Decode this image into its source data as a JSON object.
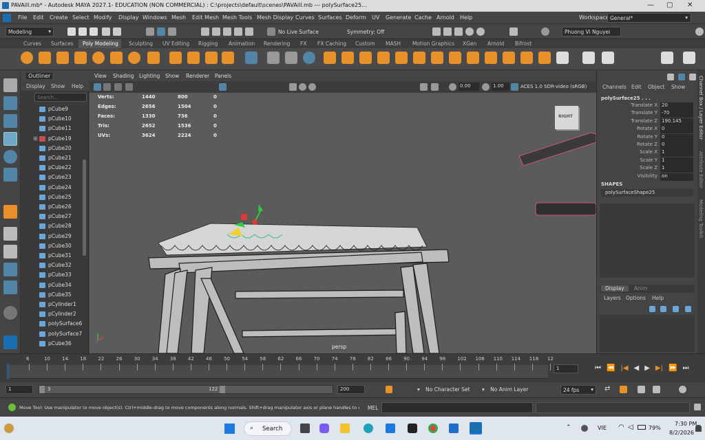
{
  "window": {
    "title": "PAVAill.mb* - Autodesk MAYA 2027.1- EDUCATION (NON COMMERCIAL) : C:\\projects\\default\\scenes\\PAVAill.mb  ---  polySurface25...",
    "minimize": "—",
    "maximize": "▢",
    "close": "✕"
  },
  "menubar": [
    "File",
    "Edit",
    "Create",
    "Select",
    "Modify",
    "Display",
    "Windows",
    "Mesh",
    "Edit Mesh",
    "Mesh Tools",
    "Mesh Display",
    "Curves",
    "Surfaces",
    "Deform",
    "UV",
    "Generate",
    "Cache",
    "Arnold",
    "Help"
  ],
  "workspace": {
    "label": "Workspace:",
    "value": "General*"
  },
  "statusline": {
    "mode": "Modeling",
    "live_surface": "No Live Surface",
    "symmetry": "Symmetry: Off",
    "user": "Phuong Vi Nguyei"
  },
  "shelf_tabs": [
    "Curves",
    "Surfaces",
    "Poly Modeling",
    "Sculpting",
    "UV Editing",
    "Rigging",
    "Animation",
    "Rendering",
    "FX",
    "FX Caching",
    "Custom",
    "MASH",
    "Motion Graphics",
    "XGen",
    "Arnold",
    "Bifrost"
  ],
  "shelf_active": "Poly Modeling",
  "outliner": {
    "title": "Outliner",
    "menu": [
      "Display",
      "Show",
      "Help"
    ],
    "search_placeholder": "Search...",
    "items": [
      "pCube9",
      "pCube10",
      "pCube11",
      "pCube19",
      "pCube20",
      "pCube21",
      "pCube22",
      "pCube23",
      "pCube24",
      "pCube25",
      "pCube26",
      "pCube27",
      "pCube28",
      "pCube29",
      "pCube30",
      "pCube31",
      "pCube32",
      "pCube33",
      "pCube34",
      "pCube35",
      "pCylinder1",
      "pCylinder2",
      "polySurface6",
      "polySurface7",
      "pCube36"
    ]
  },
  "viewport": {
    "menu": [
      "View",
      "Shading",
      "Lighting",
      "Show",
      "Renderer",
      "Panels"
    ],
    "exposure": "0.00",
    "gamma": "1.00",
    "colorspace": "ACES 1.0 SDR-video (sRGB)",
    "camera": "persp",
    "viewcube": "RIGHT",
    "hud": [
      {
        "label": "Verts:",
        "a": "1440",
        "b": "800",
        "c": "0"
      },
      {
        "label": "Edges:",
        "a": "2656",
        "b": "1504",
        "c": "0"
      },
      {
        "label": "Faces:",
        "a": "1330",
        "b": "736",
        "c": "0"
      },
      {
        "label": "Tris:",
        "a": "2652",
        "b": "1536",
        "c": "0"
      },
      {
        "label": "UVs:",
        "a": "3624",
        "b": "2224",
        "c": "0"
      }
    ]
  },
  "channelbox": {
    "menu": [
      "Channels",
      "Edit",
      "Object",
      "Show"
    ],
    "object": "polySurface25 . . .",
    "attrs": [
      {
        "name": "Translate X",
        "value": "20"
      },
      {
        "name": "Translate Y",
        "value": "-70"
      },
      {
        "name": "Translate Z",
        "value": "190.145"
      },
      {
        "name": "Rotate X",
        "value": "0"
      },
      {
        "name": "Rotate Y",
        "value": "0"
      },
      {
        "name": "Rotate Z",
        "value": "0"
      },
      {
        "name": "Scale X",
        "value": "1"
      },
      {
        "name": "Scale Y",
        "value": "1"
      },
      {
        "name": "Scale Z",
        "value": "1"
      },
      {
        "name": "Visibility",
        "value": "on"
      }
    ],
    "shapes_header": "SHAPES",
    "shape": "polySurfaceShape25",
    "layer_tabs": [
      "Display",
      "Anim"
    ],
    "layer_menu": [
      "Layers",
      "Options",
      "Help"
    ],
    "side_tabs": [
      "Channel Box / Layer Editor",
      "Attribute Editor",
      "Modeling Toolkit"
    ]
  },
  "timeline": {
    "ticks": [
      "6",
      "10",
      "14",
      "18",
      "22",
      "26",
      "30",
      "34",
      "38",
      "42",
      "46",
      "50",
      "54",
      "58",
      "62",
      "66",
      "70",
      "74",
      "78",
      "82",
      "86",
      "90",
      "94",
      "98",
      "102",
      "106",
      "110",
      "114",
      "118",
      "12"
    ],
    "current_frame": "1"
  },
  "range": {
    "start": "1",
    "inner_start": "3",
    "inner_end": "122",
    "end": "200",
    "character_set": "No Character Set",
    "anim_layer": "No Anim Layer",
    "fps": "24 fps"
  },
  "helpline": {
    "text": "Move Tool: Use manipulator to move object(s). Ctrl+middle-drag to move components along normals. Shift+drag manipulator axis or plane handles to extru",
    "mel": "MEL"
  },
  "taskbar": {
    "search": "Search",
    "lang": "VIE",
    "battery": "79%",
    "time": "7:30 PM",
    "date": "8/2/2026"
  },
  "colors": {
    "accent_blue": "#5285a6",
    "shelf_orange": "#e8902a",
    "selection": "#2e5a86"
  }
}
